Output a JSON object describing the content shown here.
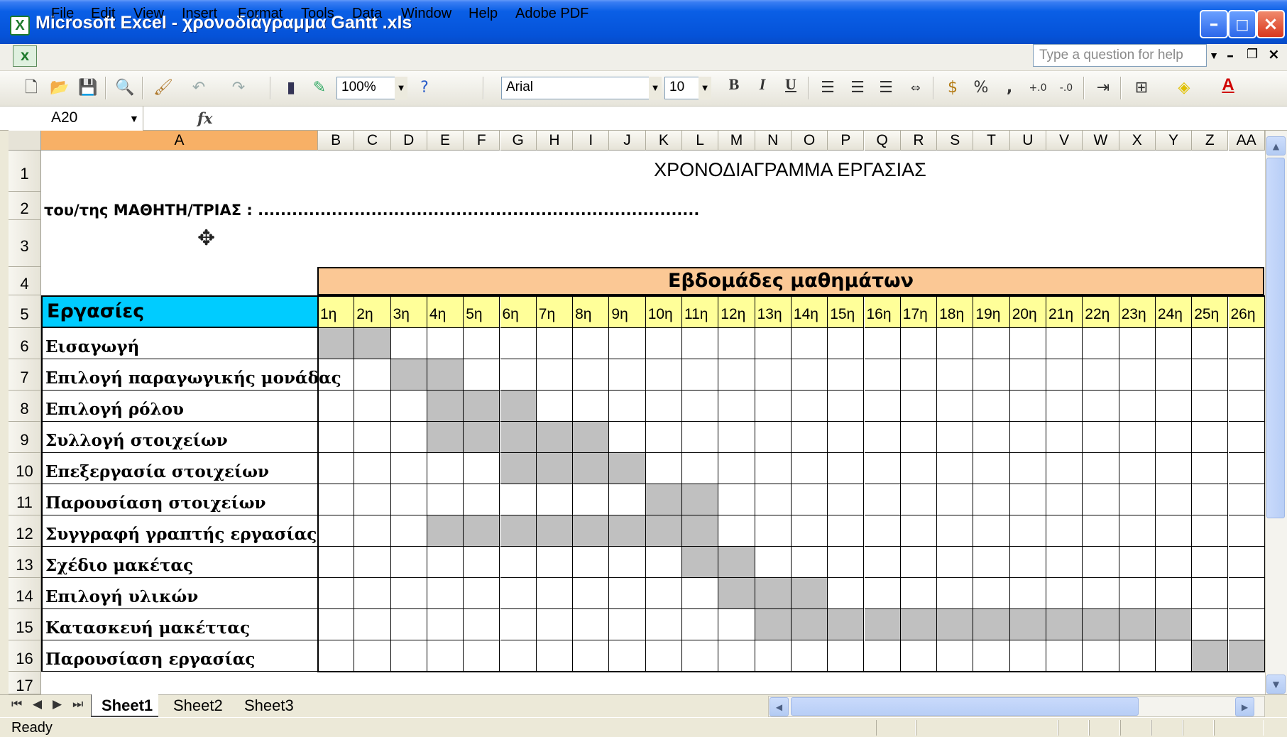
{
  "window": {
    "title": "Microsoft Excel - χρονοδιάγραμμα  Gantt .xls",
    "app_icon": "excel-icon",
    "buttons": [
      "minimize-icon",
      "maximize-icon",
      "close-icon"
    ]
  },
  "menu": {
    "items": [
      "File",
      "Edit",
      "View",
      "Insert",
      "Format",
      "Tools",
      "Data",
      "Window",
      "Help",
      "Adobe PDF"
    ],
    "help_placeholder": "Type a question for help"
  },
  "toolbar": {
    "zoom": "100%",
    "font": "Arial",
    "font_size": "10",
    "bold": "B",
    "italic": "I",
    "underline": "U",
    "percent": "%",
    "comma": ",",
    "font_color": "A"
  },
  "formula_bar": {
    "name_box": "A20",
    "fx_label": "fx"
  },
  "columns": [
    "A",
    "B",
    "C",
    "D",
    "E",
    "F",
    "G",
    "H",
    "I",
    "J",
    "K",
    "L",
    "M",
    "N",
    "O",
    "P",
    "Q",
    "R",
    "S",
    "T",
    "U",
    "V",
    "W",
    "X",
    "Y",
    "Z",
    "AA"
  ],
  "rows": [
    "1",
    "2",
    "3",
    "4",
    "5",
    "6",
    "7",
    "8",
    "9",
    "10",
    "11",
    "12",
    "13",
    "14",
    "15",
    "16",
    "17"
  ],
  "sheet": {
    "title": "ΧΡΟΝΟΔΙΑΓΡΑΜΜΑ ΕΡΓΑΣΙΑΣ",
    "student_line": "του/της  ΜΑΘΗΤΗ/ΤΡΙΑΣ :  ..............................................................................",
    "weeks_header": "Εβδομάδες μαθημάτων",
    "tasks_header": "Εργασίες",
    "weeks": [
      "1η",
      "2η",
      "3η",
      "4η",
      "5η",
      "6η",
      "7η",
      "8η",
      "9η",
      "10η",
      "11η",
      "12η",
      "13η",
      "14η",
      "15η",
      "16η",
      "17η",
      "18η",
      "19η",
      "20η",
      "21η",
      "22η",
      "23η",
      "24η",
      "25η",
      "26η"
    ],
    "tasks": [
      {
        "name": "Εισαγωγή",
        "weeks": [
          1,
          2
        ]
      },
      {
        "name": "Επιλογή παραγωγικής μονάδας",
        "weeks": [
          3,
          4
        ]
      },
      {
        "name": "Επιλογή ρόλου",
        "weeks": [
          4,
          5,
          6
        ]
      },
      {
        "name": "Συλλογή στοιχείων",
        "weeks": [
          4,
          5,
          6,
          7,
          8
        ]
      },
      {
        "name": "Επεξεργασία στοιχείων",
        "weeks": [
          6,
          7,
          8,
          9
        ]
      },
      {
        "name": "Παρουσίαση στοιχείων",
        "weeks": [
          10,
          11
        ]
      },
      {
        "name": "Συγγραφή γραπτής εργασίας",
        "weeks": [
          4,
          5,
          6,
          7,
          8,
          9,
          10,
          11
        ]
      },
      {
        "name": "Σχέδιο μακέτας",
        "weeks": [
          11,
          12
        ]
      },
      {
        "name": "Επιλογή υλικών",
        "weeks": [
          12,
          13,
          14
        ]
      },
      {
        "name": "Κατασκευή μακέττας",
        "weeks": [
          13,
          14,
          15,
          16,
          17,
          18,
          19,
          20,
          21,
          22,
          23,
          24
        ]
      },
      {
        "name": "Παρουσίαση εργασίας",
        "weeks": [
          25,
          26
        ]
      }
    ],
    "colors": {
      "weeks_header": "#fbc895",
      "tasks_header": "#00ccff",
      "week_cells": "#ffff99",
      "filled": "#c0c0c0",
      "selected_col": "#f7b066"
    }
  },
  "tabs": [
    "Sheet1",
    "Sheet2",
    "Sheet3"
  ],
  "status": "Ready"
}
